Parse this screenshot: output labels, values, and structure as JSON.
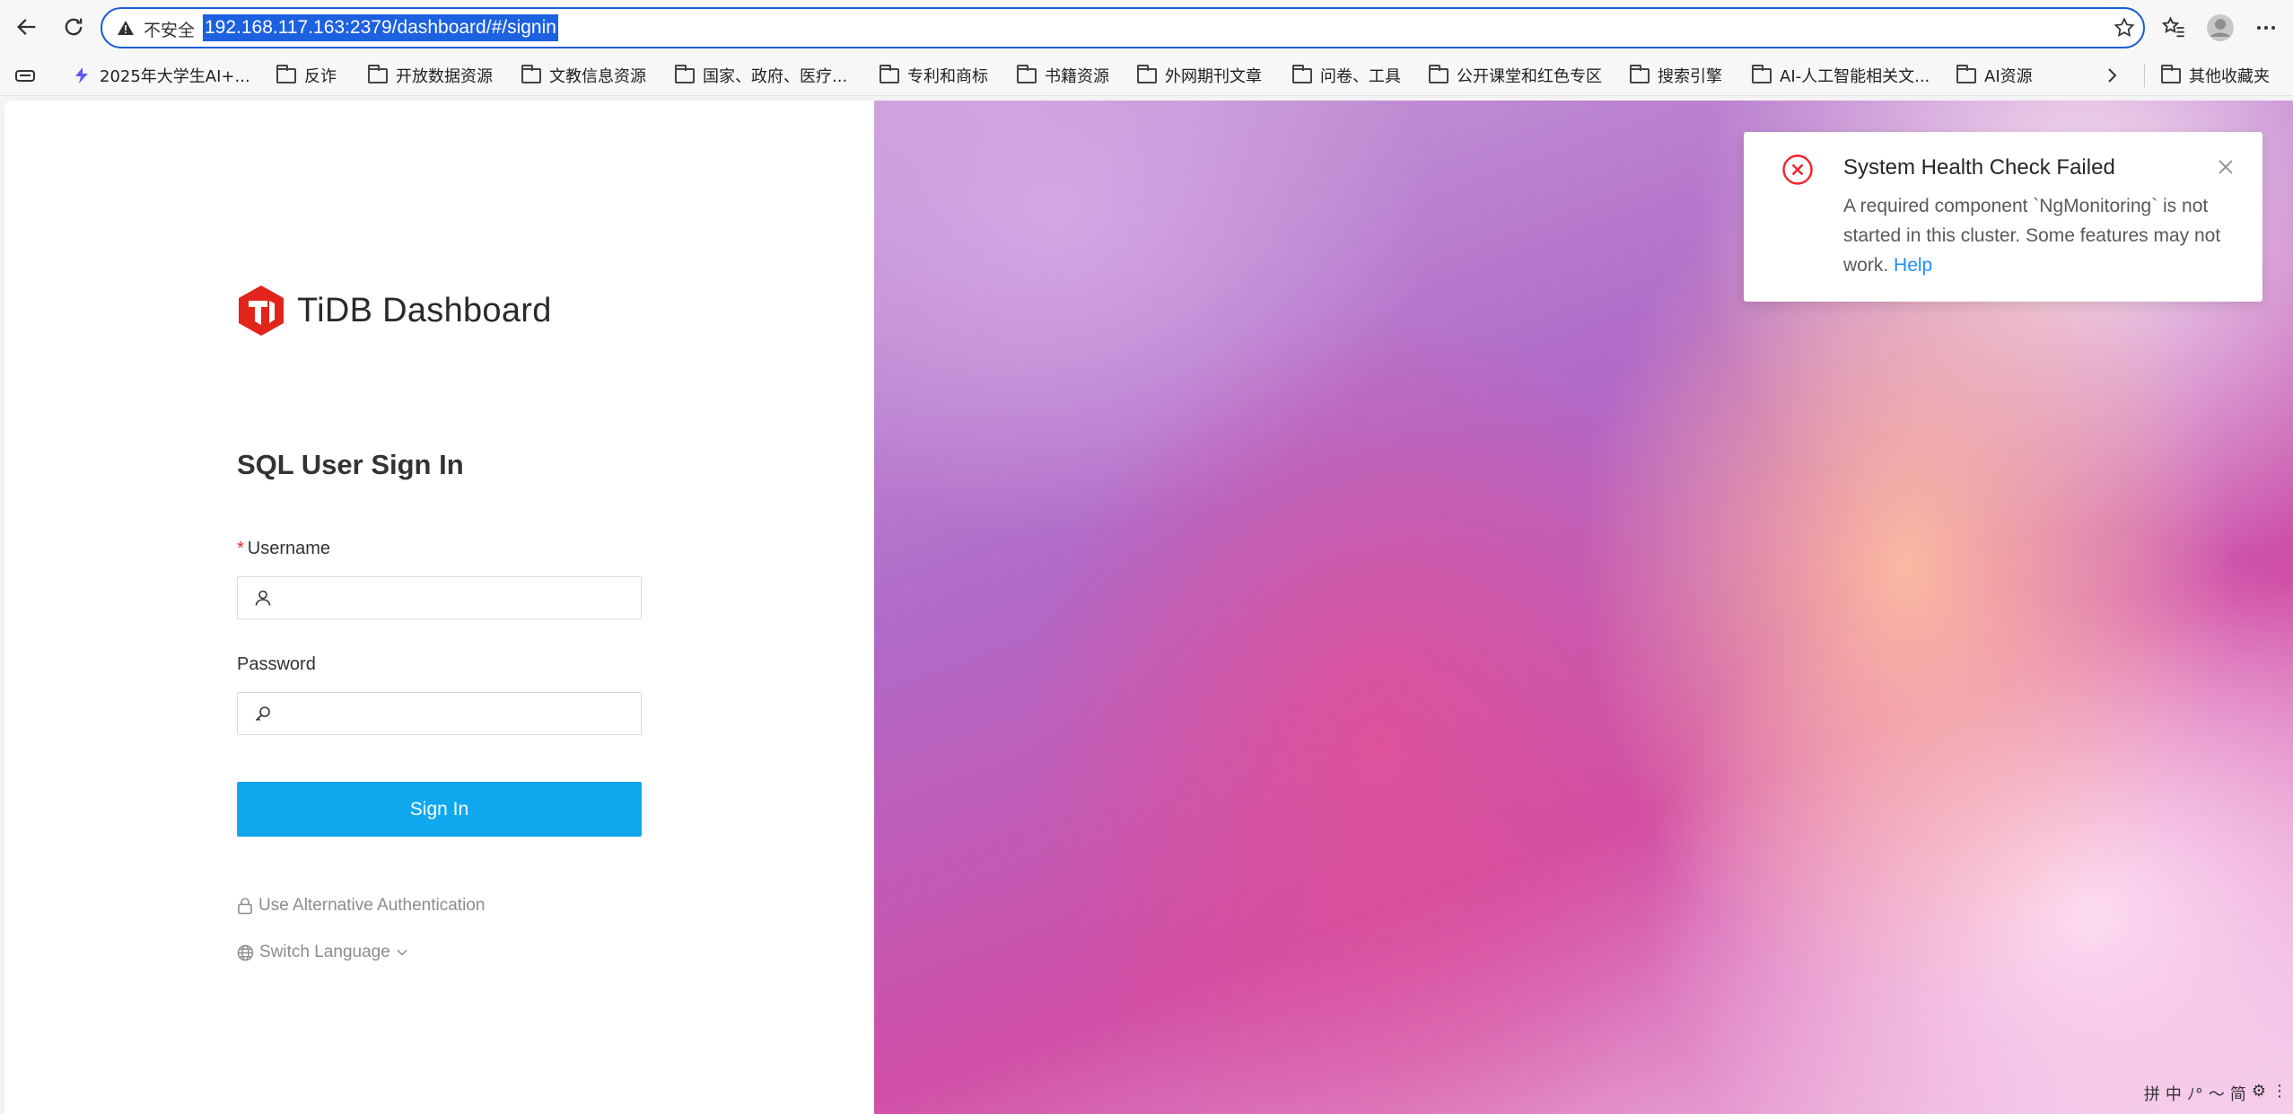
{
  "browser": {
    "security_label": "不安全",
    "url": "192.168.117.163:2379/dashboard/#/signin",
    "bookmarks": [
      {
        "label": "2025年大学生AI+..."
      },
      {
        "label": "反诈"
      },
      {
        "label": "开放数据资源"
      },
      {
        "label": "文教信息资源"
      },
      {
        "label": "国家、政府、医疗..."
      },
      {
        "label": "专利和商标"
      },
      {
        "label": "书籍资源"
      },
      {
        "label": "外网期刊文章"
      },
      {
        "label": "问卷、工具"
      },
      {
        "label": "公开课堂和红色专区"
      },
      {
        "label": "搜索引擎"
      },
      {
        "label": "AI-人工智能相关文..."
      },
      {
        "label": "AI资源"
      }
    ],
    "other_bookmarks": "其他收藏夹"
  },
  "signin": {
    "logo_text": "TiDB Dashboard",
    "title": "SQL User Sign In",
    "username_label": "Username",
    "username_required_mark": "*",
    "username_value": "",
    "password_label": "Password",
    "password_value": "",
    "submit_label": "Sign In",
    "alt_auth_label": "Use Alternative Authentication",
    "switch_language_label": "Switch Language"
  },
  "notification": {
    "title": "System Health Check Failed",
    "message": "A required component `NgMonitoring` is not started in this cluster. Some features may not work.",
    "link_label": "Help",
    "status_color": "#f5222d"
  },
  "ime_toolbar": [
    "拼",
    "中",
    "ﾉ°",
    "〜",
    "简",
    "⚙",
    "⋮"
  ],
  "colors": {
    "primary_button": "#0fa8ef",
    "brand_red": "#e1251b",
    "link": "#1890ff"
  }
}
